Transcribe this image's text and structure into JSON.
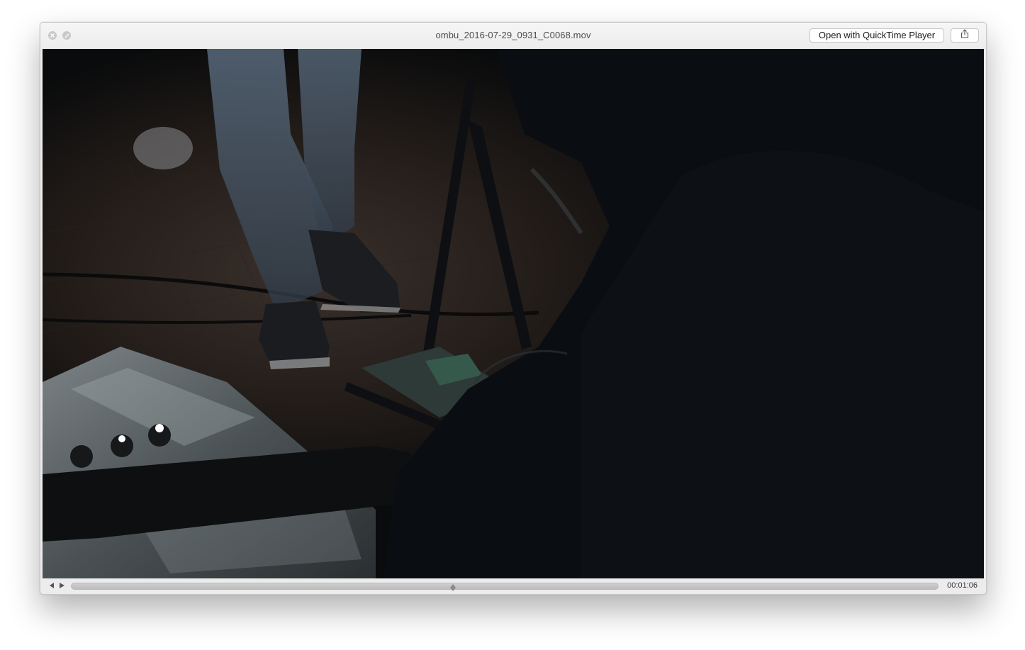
{
  "window": {
    "title": "ombu_2016-07-29_0931_C0068.mov"
  },
  "toolbar": {
    "open_button_label": "Open with QuickTime Player",
    "share_icon": "share-icon"
  },
  "traffic_lights": {
    "close_icon": "close-icon",
    "fullscreen_icon": "fullscreen-icon"
  },
  "player": {
    "current_time": "00:01:06",
    "progress_fraction": 0.44,
    "prev_icon": "step-back-icon",
    "play_icon": "play-icon"
  }
}
